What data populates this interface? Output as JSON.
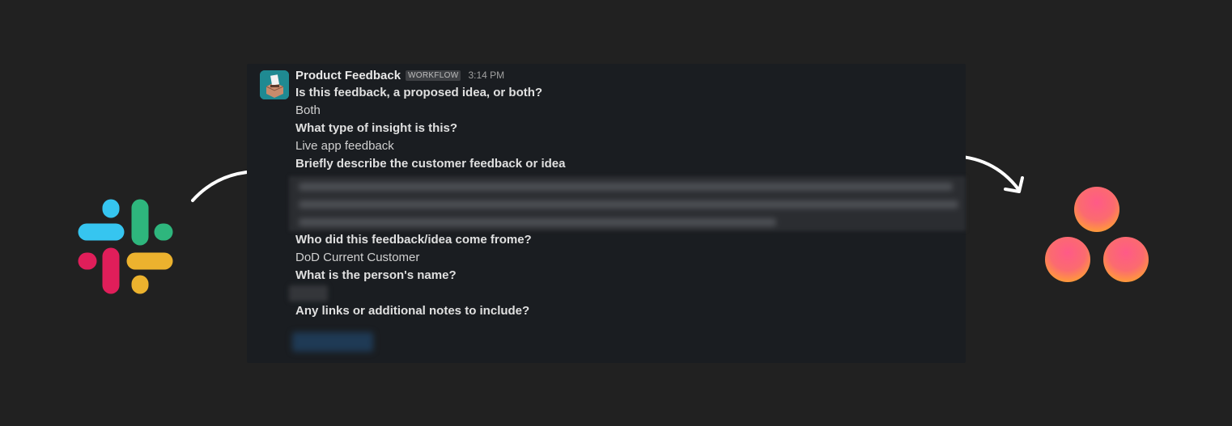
{
  "message": {
    "app_name": "Product Feedback",
    "badge": "WORKFLOW",
    "time": "3:14 PM",
    "fields": [
      {
        "question": "Is this feedback, a proposed idea, or both?",
        "answer": "Both"
      },
      {
        "question": "What type of insight is this?",
        "answer": "Live app feedback"
      },
      {
        "question": "Briefly describe the customer feedback or idea"
      },
      {
        "question": "Who did this feedback/idea come frome?",
        "answer": "DoD Current Customer"
      },
      {
        "question": "What is the person's name?"
      },
      {
        "question": "Any links or additional notes to include?"
      }
    ]
  },
  "icons": {
    "left_logo": "slack-logo-icon",
    "right_logo": "asana-logo-icon",
    "avatar": "ballot-box-icon",
    "arrows": "curved-arrow-icon"
  },
  "colors": {
    "background": "#212121",
    "card": "#1a1d21",
    "slack_blue": "#36c5f0",
    "slack_green": "#2eb67d",
    "slack_red": "#e01e5a",
    "slack_yellow": "#ecb22e",
    "asana_pink": "#f95d7b",
    "asana_orange": "#ff8a3d"
  }
}
